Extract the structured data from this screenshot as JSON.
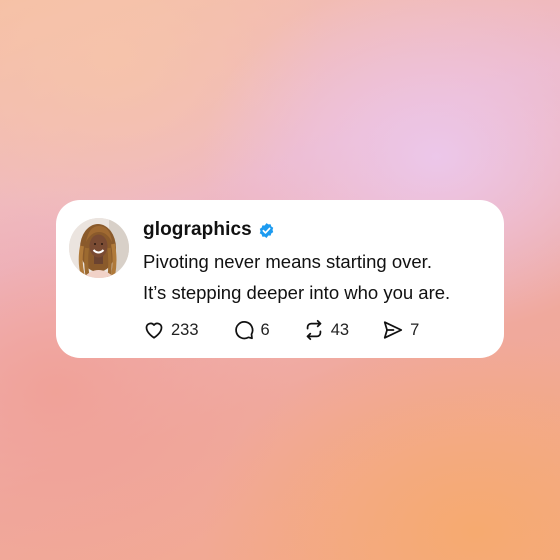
{
  "colors": {
    "card_background": "#ffffff",
    "text": "#111111",
    "verified_badge": "#1d9bf0"
  },
  "post": {
    "username": "glographics",
    "verified": true,
    "lines": [
      "Pivoting never means starting over.",
      "It’s stepping deeper into who you are."
    ],
    "actions": {
      "likes": {
        "icon": "heart-icon",
        "count": "233"
      },
      "comments": {
        "icon": "comment-icon",
        "count": "6"
      },
      "reposts": {
        "icon": "repost-icon",
        "count": "43"
      },
      "shares": {
        "icon": "share-icon",
        "count": "7"
      }
    }
  }
}
